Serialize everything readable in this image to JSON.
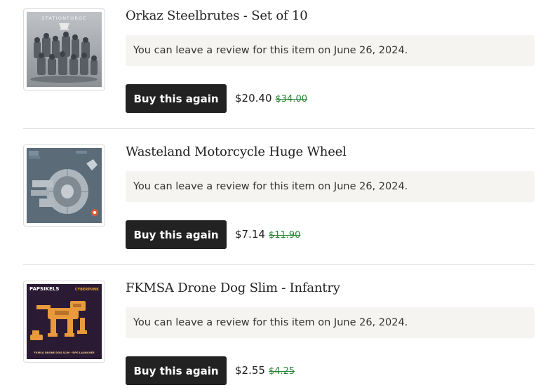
{
  "orders": [
    {
      "title": "Orkaz Steelbrutes - Set of 10",
      "review_note": "You can leave a review for this item on June 26, 2024.",
      "button_label": "Buy this again",
      "price": "$20.40",
      "original_price": "$34.00",
      "thumbnail_brand": "STATIONFORGE"
    },
    {
      "title": "Wasteland Motorcycle Huge Wheel",
      "review_note": "You can leave a review for this item on June 26, 2024.",
      "button_label": "Buy this again",
      "price": "$7.14",
      "original_price": "$11.90"
    },
    {
      "title": "FKMSA Drone Dog Slim - Infantry",
      "review_note": "You can leave a review for this item on June 26, 2024.",
      "button_label": "Buy this again",
      "price": "$2.55",
      "original_price": "$4.25",
      "thumbnail_brand": "PAPSIKELS",
      "thumbnail_tag": "CYBERPUNK",
      "thumbnail_caption": "FKMSA DRONE DOG SLIM - RPG LAUNCHER"
    }
  ],
  "colors": {
    "button_bg": "#222222",
    "button_text": "#ffffff",
    "review_bg": "#f5f4f1",
    "original_price": "#258635",
    "divider": "#dcdcdc"
  }
}
